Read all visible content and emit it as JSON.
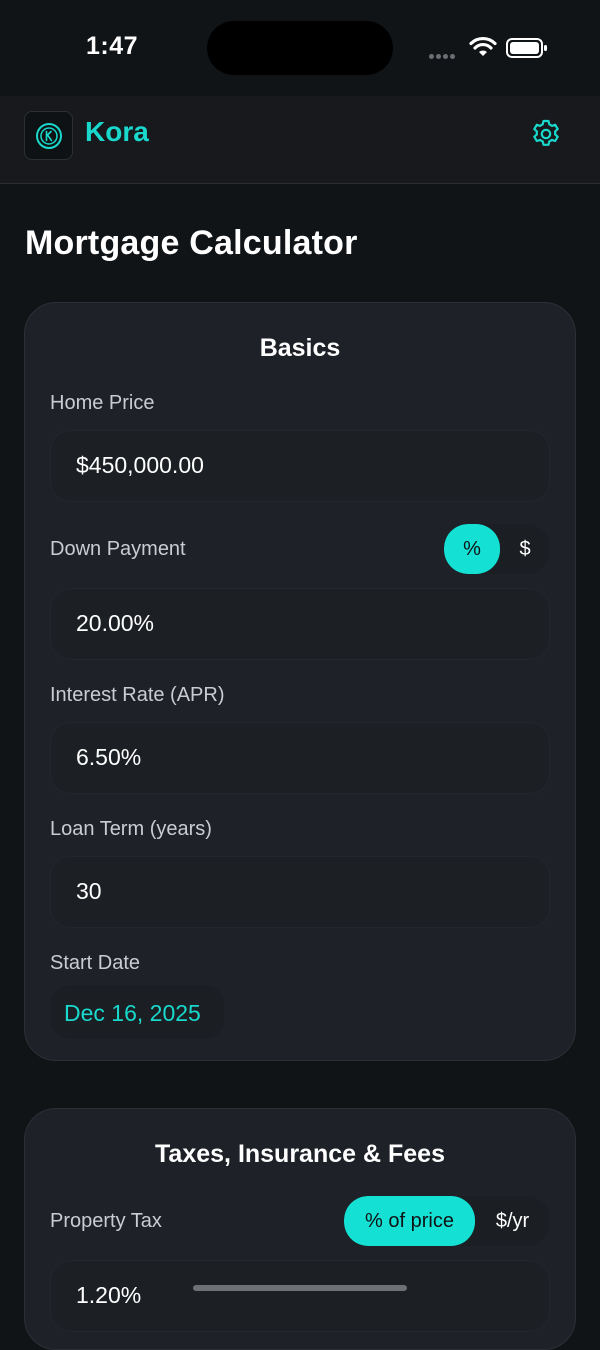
{
  "status_bar": {
    "time": "1:47"
  },
  "header": {
    "brand": "Kora"
  },
  "page": {
    "title": "Mortgage Calculator"
  },
  "basics": {
    "title": "Basics",
    "home_price": {
      "label": "Home Price",
      "value": "$450,000.00"
    },
    "down_payment": {
      "label": "Down Payment",
      "value": "20.00%",
      "toggle": {
        "options": [
          "%",
          "$"
        ],
        "selected": "%"
      }
    },
    "interest_rate": {
      "label": "Interest Rate (APR)",
      "value": "6.50%"
    },
    "loan_term": {
      "label": "Loan Term (years)",
      "value": "30"
    },
    "start_date": {
      "label": "Start Date",
      "value": "Dec 16, 2025"
    }
  },
  "taxes": {
    "title": "Taxes, Insurance & Fees",
    "property_tax": {
      "label": "Property Tax",
      "value": "1.20%",
      "toggle": {
        "options": [
          "% of price",
          "$/yr"
        ],
        "selected": "% of price"
      }
    }
  },
  "colors": {
    "accent": "#14e0d3",
    "background": "#111417",
    "card": "#1e2228"
  }
}
